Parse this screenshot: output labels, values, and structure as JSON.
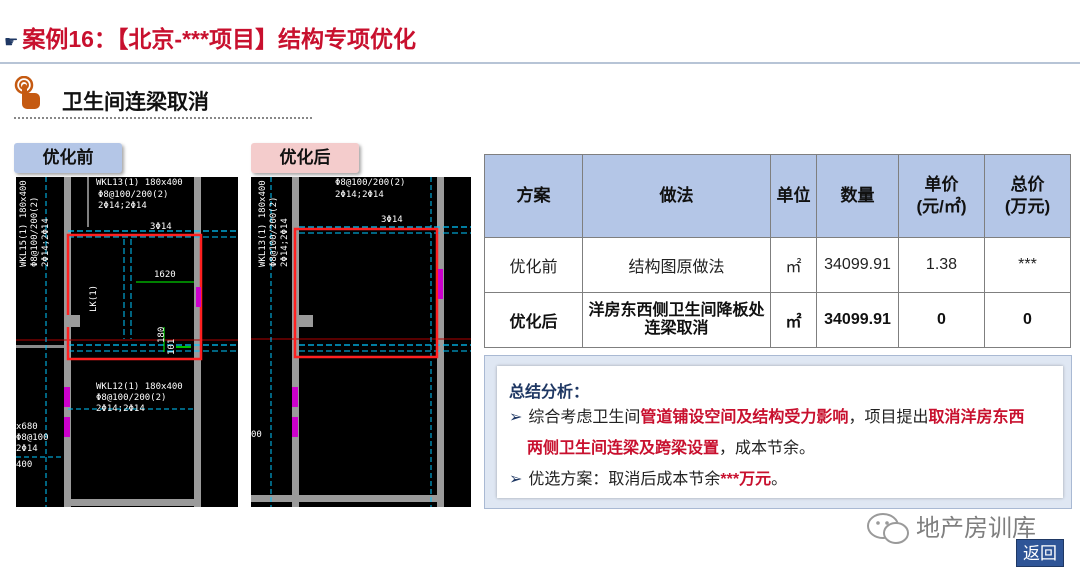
{
  "header": {
    "hand_glyph": "☛",
    "title": "案例16：【北京-***项目】结构专项优化"
  },
  "section": {
    "title": "卫生间连梁取消",
    "icon": "pointing-finger-icon"
  },
  "tags": {
    "before": "优化前",
    "after": "优化后"
  },
  "cad": {
    "before_labels": [
      "WKL13(1) 180x400",
      "Φ8@100/200(2)",
      "2Φ14;2Φ14",
      "3Φ14",
      "1620",
      "LK(1)",
      "180",
      "101",
      "WKL12(1) 180x400",
      "Φ8@100/200(2)",
      "2Φ14;2Φ14",
      "x680",
      "Φ8@100",
      "2Φ14",
      "400",
      "WKL15(1) 180x400",
      "Φ8@100/200(2)",
      "2Φ14;2Φ14"
    ],
    "after_labels": [
      "WKL13(1) 180x400",
      "Φ8@100/200(2)",
      "2Φ14;2Φ14",
      "3Φ14",
      "00"
    ]
  },
  "table": {
    "headers": [
      "方案",
      "做法",
      "单位",
      "数量",
      "单价\n(元/㎡)",
      "总价\n(万元)"
    ],
    "rows": [
      {
        "scheme": "优化前",
        "method": "结构图原做法",
        "unit": "㎡",
        "qty": "34099.91",
        "price": "1.38",
        "total": "***"
      },
      {
        "scheme": "优化后",
        "method": "洋房东西侧卫生间降板处连梁取消",
        "unit": "㎡",
        "qty": "34099.91",
        "price": "0",
        "total": "0"
      }
    ]
  },
  "summary": {
    "heading": "总结分析：",
    "bullet_marker": "➢",
    "b1_plain1": "综合考虑卫生间",
    "b1_red1": "管道铺设空间及结构受力影响",
    "b1_plain2": "，项目提出",
    "b1_red2": "取消洋房东西",
    "b1_red3": "两侧卫生间连梁及跨梁设置",
    "b1_plain3": "，成本节余。",
    "b2_plain": "优选方案：取消后成本节余",
    "b2_red": "***万元",
    "b2_end": "。"
  },
  "footer": {
    "wechat": "地产房训库",
    "back": "返回"
  },
  "colors": {
    "title_red": "#c8102e",
    "header_blue": "#b4c6e7",
    "after_pink": "#f4cccc",
    "back_blue": "#2f5597"
  }
}
